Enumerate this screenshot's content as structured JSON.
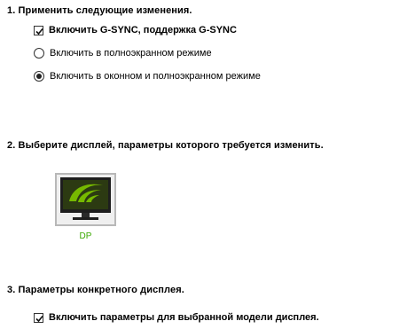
{
  "section1": {
    "title": "1. Применить следующие изменения.",
    "gsync_checkbox_label": "Включить G-SYNC, поддержка G-SYNC",
    "gsync_checked": true,
    "radio_fullscreen_label": "Включить в полноэкранном режиме",
    "radio_windowed_label": "Включить в оконном и полноэкранном режиме",
    "selected_mode": "windowed_and_fullscreen"
  },
  "section2": {
    "title": "2. Выберите дисплей, параметры которого требуется изменить.",
    "display": {
      "name": "DP",
      "icon": "nvidia-monitor-icon"
    }
  },
  "section3": {
    "title": "3. Параметры конкретного дисплея.",
    "model_checkbox_label": "Включить параметры для выбранной модели дисплея.",
    "model_checked": true
  },
  "colors": {
    "accent": "#76b900",
    "display_label": "#3aa800"
  }
}
